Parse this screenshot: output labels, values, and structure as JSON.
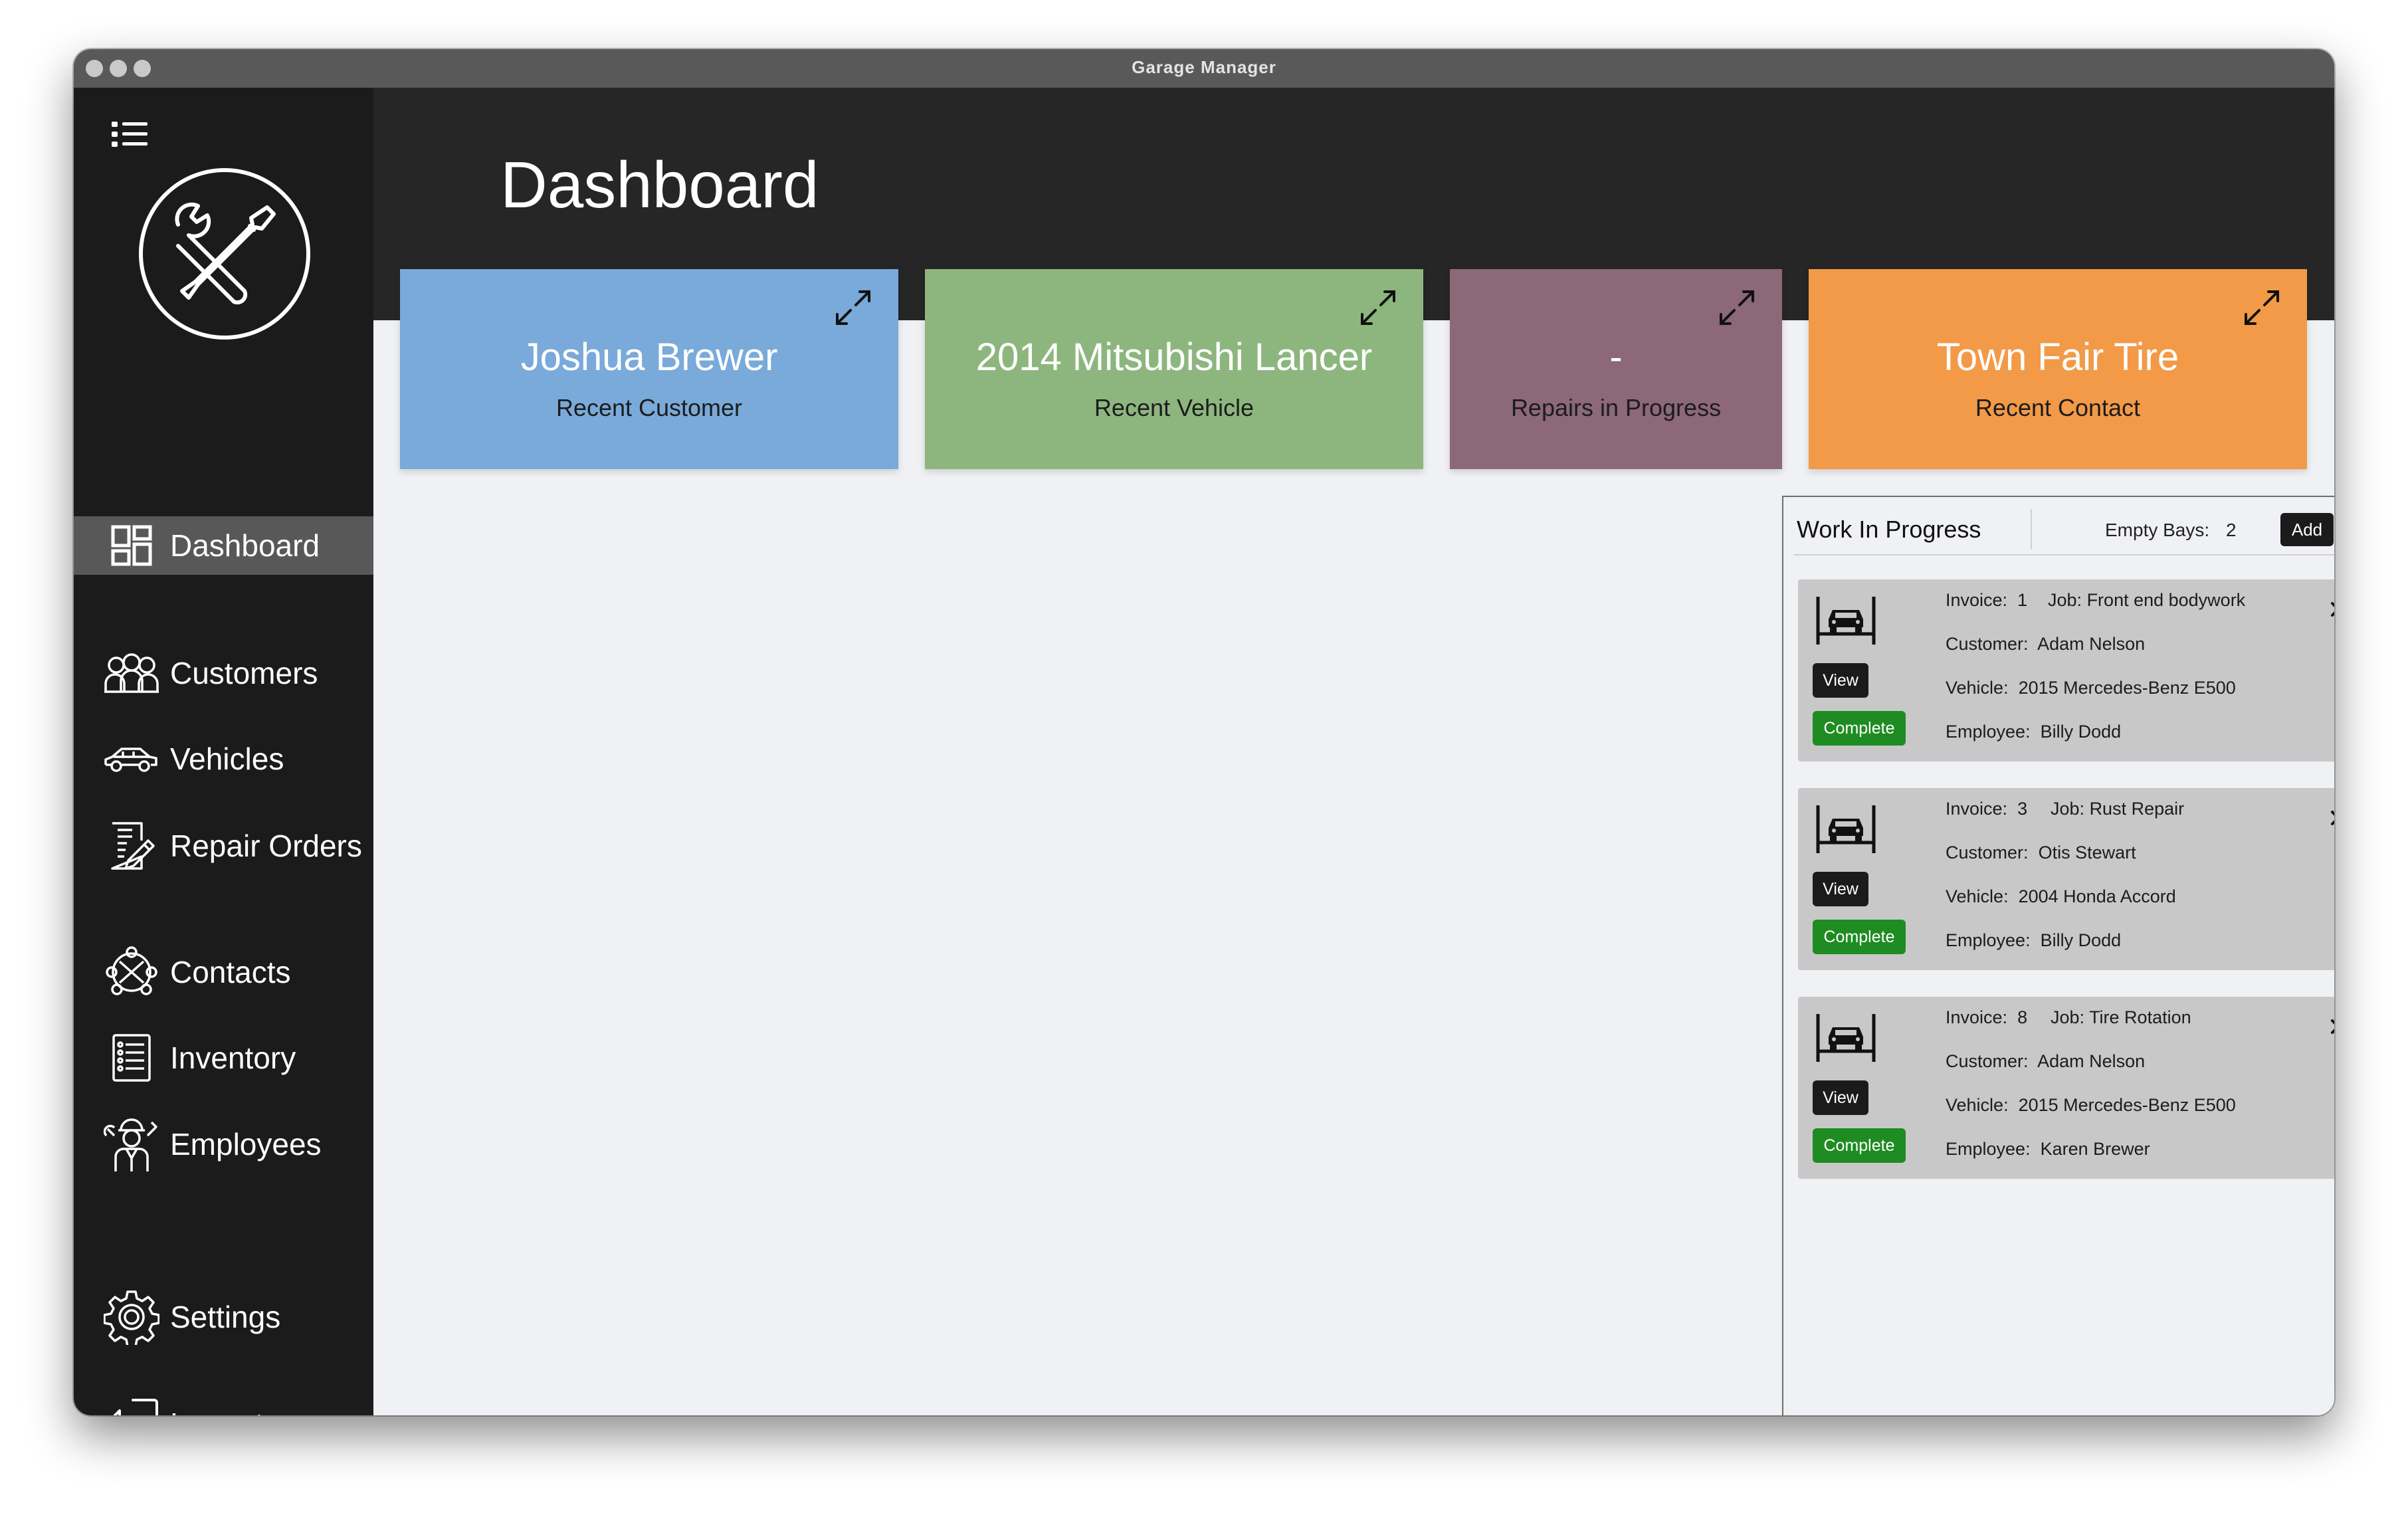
{
  "window": {
    "title": "Garage Manager"
  },
  "sidebar": {
    "items": [
      {
        "label": "Dashboard",
        "icon": "dashboard-icon",
        "active": true
      },
      {
        "label": "Customers",
        "icon": "customers-icon"
      },
      {
        "label": "Vehicles",
        "icon": "vehicle-icon"
      },
      {
        "label": "Repair Orders",
        "icon": "repair-orders-icon"
      },
      {
        "label": "Contacts",
        "icon": "contacts-icon"
      },
      {
        "label": "Inventory",
        "icon": "inventory-icon"
      },
      {
        "label": "Employees",
        "icon": "employees-icon"
      },
      {
        "label": "Settings",
        "icon": "gear-icon"
      },
      {
        "label": "Logout",
        "icon": "logout-icon"
      }
    ]
  },
  "header": {
    "title": "Dashboard"
  },
  "cards": [
    {
      "value": "Joshua Brewer",
      "label": "Recent Customer",
      "color": "#79aad9"
    },
    {
      "value": "2014 Mitsubishi Lancer",
      "label": "Recent Vehicle",
      "color": "#8db67e"
    },
    {
      "value": "-",
      "label": "Repairs in Progress",
      "color": "#8c6878"
    },
    {
      "value": "Town Fair Tire",
      "label": "Recent Contact",
      "color": "#f29a48"
    }
  ],
  "wip": {
    "title": "Work In Progress",
    "empty_bays_label": "Empty Bays:",
    "empty_bays_value": "2",
    "add_label": "Add",
    "view_label": "View",
    "complete_label": "Complete",
    "field_labels": {
      "invoice": "Invoice:",
      "job": "Job:",
      "customer": "Customer:",
      "vehicle": "Vehicle:",
      "employee": "Employee:"
    },
    "jobs": [
      {
        "invoice": "1",
        "job": "Front end bodywork",
        "customer": "Adam Nelson",
        "vehicle": "2015 Mercedes-Benz E500",
        "employee": "Billy Dodd"
      },
      {
        "invoice": "3",
        "job": "Rust Repair",
        "customer": "Otis Stewart",
        "vehicle": "2004 Honda Accord",
        "employee": "Billy Dodd"
      },
      {
        "invoice": "8",
        "job": "Tire Rotation",
        "customer": "Adam Nelson",
        "vehicle": "2015 Mercedes-Benz E500",
        "employee": "Karen Brewer"
      }
    ]
  },
  "colors": {
    "complete": "#1e8c22",
    "sidebar": "#1b1b1b",
    "header": "#262626",
    "active_nav": "#585858"
  }
}
